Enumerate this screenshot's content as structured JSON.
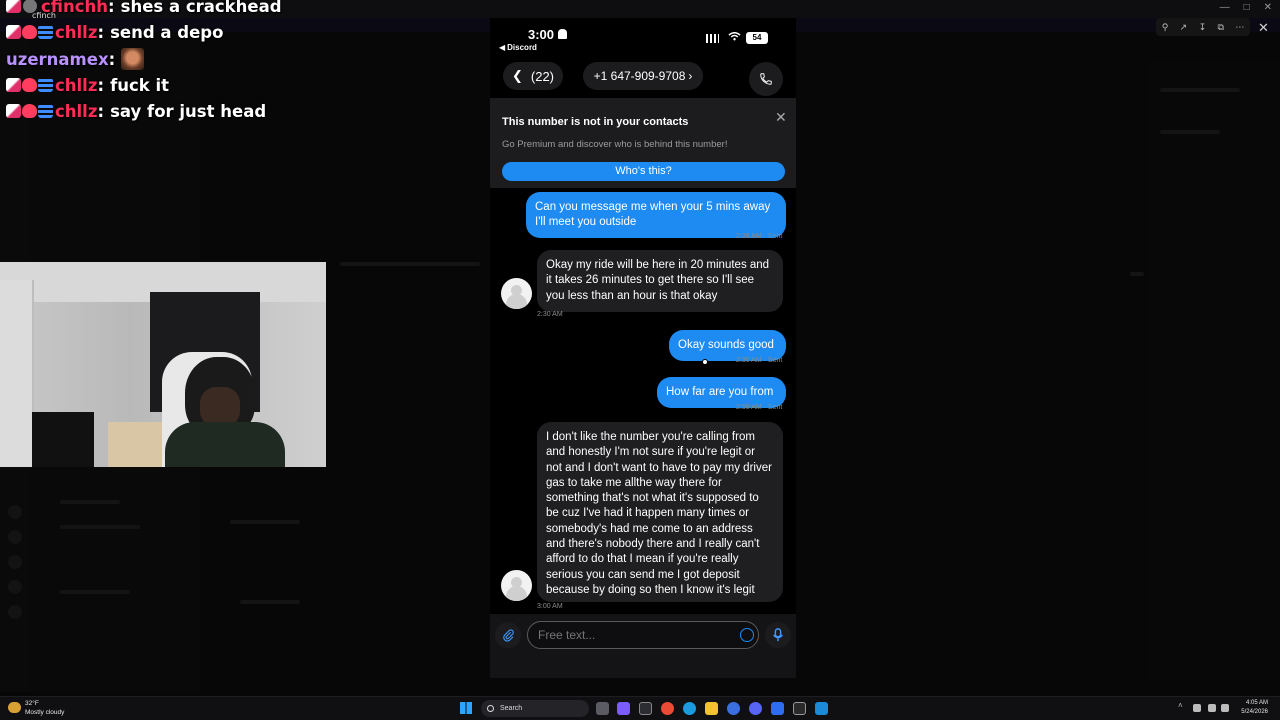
{
  "chat": {
    "lines": [
      {
        "user": "cfinchh",
        "user_color": "#ff2d55",
        "text": "shes a crackhead"
      },
      {
        "user": "chllz",
        "user_color": "#ff2d55",
        "text": "send a depo"
      },
      {
        "user": "uzernamex",
        "user_color": "#b891ff",
        "text": ""
      },
      {
        "user": "chllz",
        "user_color": "#ff2d55",
        "text": "fuck it"
      },
      {
        "user": "chllz",
        "user_color": "#ff2d55",
        "text": "say for just head"
      }
    ],
    "overlap_name": "cfinch"
  },
  "phone": {
    "status": {
      "time": "3:00",
      "back_app": "Discord",
      "battery": "54"
    },
    "nav": {
      "back_count": "(22)",
      "number": "+1 647-909-9708"
    },
    "banner": {
      "title": "This number is not in your contacts",
      "subtitle": "Go Premium and discover who is behind this number!",
      "button": "Who's this?"
    },
    "messages": [
      {
        "dir": "out",
        "text": "Can you message me when your 5 mins away I'll meet you outside",
        "meta": "2:26 AM · Sent"
      },
      {
        "dir": "in",
        "text": "Okay my ride will be here in 20 minutes and it takes 26 minutes to get there so I'll see you less than an hour is that okay",
        "meta": "2:30 AM"
      },
      {
        "dir": "out",
        "text": "Okay sounds good",
        "meta": "2:30 AM · Sent"
      },
      {
        "dir": "out",
        "text": "How far are you from",
        "meta": "2:58 AM · Sent"
      },
      {
        "dir": "in",
        "text": "I don't like the number you're calling from and honestly I'm not sure if you're legit or not and I don't want to have to pay my driver gas to take me allthe way there for something that's not what it's supposed to be cuz I've had it happen many times or somebody's had me come to an address and there's nobody there and I really can't afford to do that I mean if you're really serious you can send me I got deposit because by doing so then I know it's legit",
        "meta": "3:00 AM"
      }
    ],
    "composer": {
      "placeholder": "Free text..."
    }
  },
  "taskbar": {
    "weather_temp": "32°F",
    "weather_desc": "Mostly cloudy",
    "search_label": "Search",
    "time": "4:05 AM",
    "date": "5/24/2026"
  },
  "colors": {
    "accent_blue": "#1d8bf1",
    "incoming_bubble": "#1f1f21",
    "chat_user_pink": "#ff2d55",
    "chat_user_purple": "#b891ff"
  }
}
